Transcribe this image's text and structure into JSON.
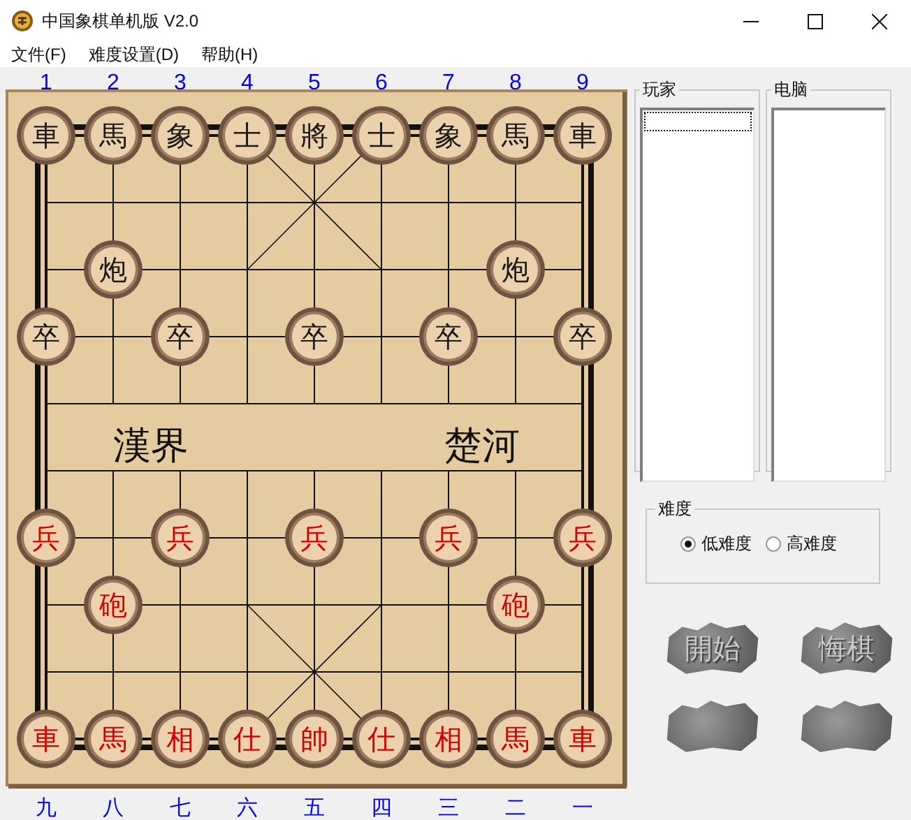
{
  "window": {
    "title": "中国象棋单机版 V2.0"
  },
  "menu": [
    {
      "label": "文件(F)"
    },
    {
      "label": "难度设置(D)"
    },
    {
      "label": "帮助(H)"
    }
  ],
  "board": {
    "top_numbers": [
      "1",
      "2",
      "3",
      "4",
      "5",
      "6",
      "7",
      "8",
      "9"
    ],
    "bottom_numbers": [
      "九",
      "八",
      "七",
      "六",
      "五",
      "四",
      "三",
      "二",
      "一"
    ],
    "river": [
      "漢界",
      "楚河"
    ],
    "ranks": [
      [
        {
          "kind": "piece",
          "label": "車",
          "color": "#1a1a1a"
        },
        {
          "kind": "piece",
          "label": "馬",
          "color": "#1a1a1a"
        },
        {
          "kind": "piece",
          "label": "象",
          "color": "#1a1a1a"
        },
        {
          "kind": "piece",
          "label": "士",
          "color": "#1a1a1a"
        },
        {
          "kind": "piece",
          "label": "將",
          "color": "#1a1a1a"
        },
        {
          "kind": "piece",
          "label": "士",
          "color": "#1a1a1a"
        },
        {
          "kind": "piece",
          "label": "象",
          "color": "#1a1a1a"
        },
        {
          "kind": "piece",
          "label": "馬",
          "color": "#1a1a1a"
        },
        {
          "kind": "piece",
          "label": "車",
          "color": "#1a1a1a"
        }
      ],
      [
        {
          "kind": "empty"
        },
        {
          "kind": "empty"
        },
        {
          "kind": "empty"
        },
        {
          "kind": "empty"
        },
        {
          "kind": "empty"
        },
        {
          "kind": "empty"
        },
        {
          "kind": "empty"
        },
        {
          "kind": "empty"
        },
        {
          "kind": "empty"
        }
      ],
      [
        {
          "kind": "empty"
        },
        {
          "kind": "piece",
          "label": "炮",
          "color": "#1a1a1a"
        },
        {
          "kind": "empty"
        },
        {
          "kind": "empty"
        },
        {
          "kind": "empty"
        },
        {
          "kind": "empty"
        },
        {
          "kind": "empty"
        },
        {
          "kind": "piece",
          "label": "炮",
          "color": "#1a1a1a"
        },
        {
          "kind": "empty"
        }
      ],
      [
        {
          "kind": "piece",
          "label": "卒",
          "color": "#1a1a1a"
        },
        {
          "kind": "empty"
        },
        {
          "kind": "piece",
          "label": "卒",
          "color": "#1a1a1a"
        },
        {
          "kind": "empty"
        },
        {
          "kind": "piece",
          "label": "卒",
          "color": "#1a1a1a"
        },
        {
          "kind": "empty"
        },
        {
          "kind": "piece",
          "label": "卒",
          "color": "#1a1a1a"
        },
        {
          "kind": "empty"
        },
        {
          "kind": "piece",
          "label": "卒",
          "color": "#1a1a1a"
        }
      ],
      [
        {
          "kind": "empty"
        },
        {
          "kind": "empty"
        },
        {
          "kind": "empty"
        },
        {
          "kind": "empty"
        },
        {
          "kind": "empty"
        },
        {
          "kind": "empty"
        },
        {
          "kind": "empty"
        },
        {
          "kind": "empty"
        },
        {
          "kind": "empty"
        }
      ],
      [
        {
          "kind": "empty"
        },
        {
          "kind": "empty"
        },
        {
          "kind": "empty"
        },
        {
          "kind": "empty"
        },
        {
          "kind": "empty"
        },
        {
          "kind": "empty"
        },
        {
          "kind": "empty"
        },
        {
          "kind": "empty"
        },
        {
          "kind": "empty"
        }
      ],
      [
        {
          "kind": "piece",
          "label": "兵",
          "color": "#d40000"
        },
        {
          "kind": "empty"
        },
        {
          "kind": "piece",
          "label": "兵",
          "color": "#d40000"
        },
        {
          "kind": "empty"
        },
        {
          "kind": "piece",
          "label": "兵",
          "color": "#d40000"
        },
        {
          "kind": "empty"
        },
        {
          "kind": "piece",
          "label": "兵",
          "color": "#d40000"
        },
        {
          "kind": "empty"
        },
        {
          "kind": "piece",
          "label": "兵",
          "color": "#d40000"
        }
      ],
      [
        {
          "kind": "empty"
        },
        {
          "kind": "piece",
          "label": "砲",
          "color": "#d40000"
        },
        {
          "kind": "empty"
        },
        {
          "kind": "empty"
        },
        {
          "kind": "empty"
        },
        {
          "kind": "empty"
        },
        {
          "kind": "empty"
        },
        {
          "kind": "piece",
          "label": "砲",
          "color": "#d40000"
        },
        {
          "kind": "empty"
        }
      ],
      [
        {
          "kind": "empty"
        },
        {
          "kind": "empty"
        },
        {
          "kind": "empty"
        },
        {
          "kind": "empty"
        },
        {
          "kind": "empty"
        },
        {
          "kind": "empty"
        },
        {
          "kind": "empty"
        },
        {
          "kind": "empty"
        },
        {
          "kind": "empty"
        }
      ],
      [
        {
          "kind": "piece",
          "label": "車",
          "color": "#d40000"
        },
        {
          "kind": "piece",
          "label": "馬",
          "color": "#d40000"
        },
        {
          "kind": "piece",
          "label": "相",
          "color": "#d40000"
        },
        {
          "kind": "piece",
          "label": "仕",
          "color": "#d40000"
        },
        {
          "kind": "piece",
          "label": "帥",
          "color": "#d40000"
        },
        {
          "kind": "piece",
          "label": "仕",
          "color": "#d40000"
        },
        {
          "kind": "piece",
          "label": "相",
          "color": "#d40000"
        },
        {
          "kind": "piece",
          "label": "馬",
          "color": "#d40000"
        },
        {
          "kind": "piece",
          "label": "車",
          "color": "#d40000"
        }
      ]
    ]
  },
  "player_panel": {
    "title": "玩家"
  },
  "computer_panel": {
    "title": "电脑"
  },
  "difficulty": {
    "title": "难度",
    "options": [
      {
        "label": "低难度",
        "selected": true
      },
      {
        "label": "高难度",
        "selected": false
      }
    ]
  },
  "buttons": [
    {
      "label": "開始"
    },
    {
      "label": "悔棋"
    }
  ]
}
